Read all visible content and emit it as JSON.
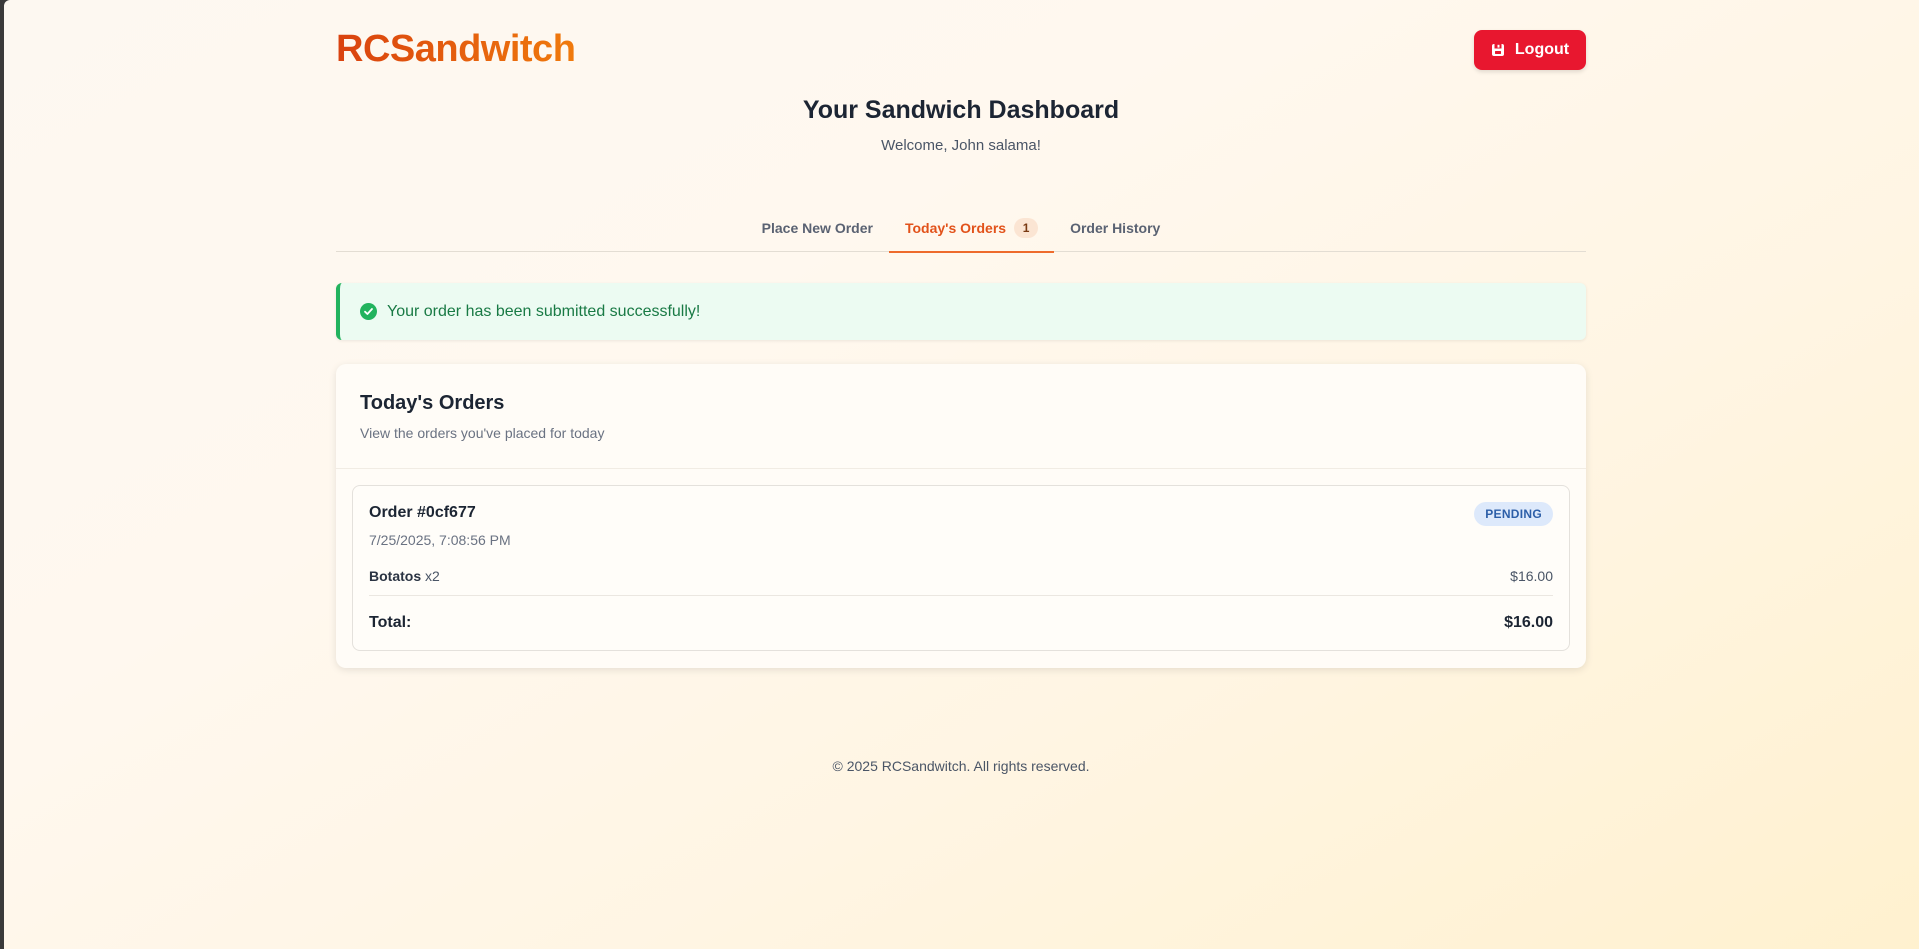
{
  "brand": {
    "name": "RCSandwitch"
  },
  "header": {
    "logout_label": "Logout"
  },
  "dashboard": {
    "title": "Your Sandwich Dashboard",
    "welcome": "Welcome, John salama!"
  },
  "tabs": [
    {
      "label": "Place New Order",
      "active": false
    },
    {
      "label": "Today's Orders",
      "active": true,
      "badge": "1"
    },
    {
      "label": "Order History",
      "active": false
    }
  ],
  "alert": {
    "message": "Your order has been submitted successfully!"
  },
  "orders_card": {
    "title": "Today's Orders",
    "subtitle": "View the orders you've placed for today",
    "orders": [
      {
        "id": "Order #0cf677",
        "date": "7/25/2025, 7:08:56 PM",
        "status": "PENDING",
        "items": [
          {
            "name": "Botatos",
            "qty": "x2",
            "price": "$16.00"
          }
        ],
        "total_label": "Total:",
        "total_value": "$16.00"
      }
    ]
  },
  "footer": {
    "text": "© 2025 RCSandwitch. All rights reserved."
  },
  "colors": {
    "brand_orange": "#e2521a",
    "logout_red": "#e8172f",
    "success_green": "#22b35e",
    "pending_blue": "#2d5fa8"
  }
}
